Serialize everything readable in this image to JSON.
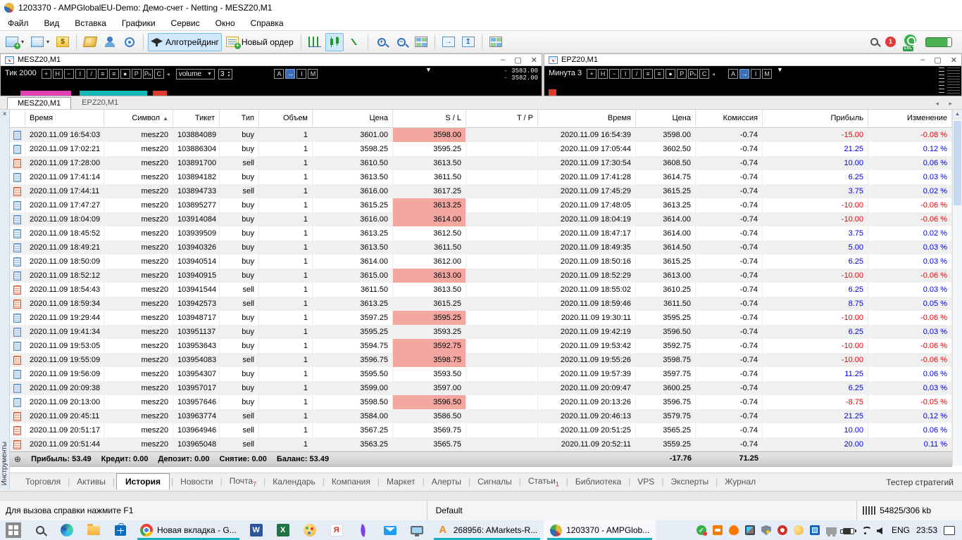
{
  "window": {
    "title": "1203370 - AMPGlobalEU-Demo: Демо-счет - Netting - MESZ20,M1"
  },
  "menu": [
    "Файл",
    "Вид",
    "Вставка",
    "Графики",
    "Сервис",
    "Окно",
    "Справка"
  ],
  "glyphs": {
    "caret": "▾",
    "caret_down": "▼",
    "sort_asc": "▲",
    "marker": "▼",
    "min": "–",
    "max": "▢",
    "close": "✕",
    "x": "×",
    "up_small": "▲",
    "down_small": "▼",
    "scroll_up": "▲",
    "tab_left": "◂",
    "tab_right": "▸",
    "expand": "⊕",
    "divider": "◂"
  },
  "toolbar": {
    "items": [
      {
        "name": "new-chart",
        "dropdown": true
      },
      {
        "name": "profiles",
        "dropdown": true
      },
      {
        "name": "symbols"
      },
      "sep",
      {
        "name": "history-center"
      },
      {
        "name": "community"
      },
      {
        "name": "broadcast"
      },
      "sep",
      {
        "name": "algo-cap",
        "label": "Алготрейдинг",
        "active": true
      },
      {
        "name": "order-doc",
        "label": "Новый ордер"
      },
      "sep",
      {
        "name": "bars-chart"
      },
      {
        "name": "candles-chart",
        "active": true
      },
      {
        "name": "line-chart"
      },
      "sep",
      {
        "name": "zoom-in"
      },
      {
        "name": "zoom-out"
      },
      {
        "name": "tile-windows"
      },
      "sep",
      {
        "name": "shift-end"
      },
      {
        "name": "auto-scroll"
      },
      "sep",
      {
        "name": "arrange-windows"
      }
    ],
    "search_badge": "1",
    "lvl_label": "LVL"
  },
  "charts": [
    {
      "title": "MESZ20,M1",
      "mode_label": "Тик  2000",
      "buttons": [
        "+",
        "H",
        "−",
        "I",
        "/",
        "≡",
        "≡",
        "●",
        "P",
        "Pₕ",
        "C"
      ],
      "dropdown": "volume",
      "spin": "3",
      "right_buttons": [
        "A",
        "→",
        "I",
        "M"
      ],
      "prices": [
        "3583.00",
        "3582.00"
      ]
    },
    {
      "title": "EPZ20,M1",
      "mode_label": "Минута  3",
      "buttons": [
        "+",
        "H",
        "−",
        "I",
        "/",
        "≡",
        "≡",
        "●",
        "P",
        "Pₕ",
        "C"
      ],
      "right_buttons": [
        "A",
        "→",
        "I",
        "M"
      ],
      "prices": []
    }
  ],
  "chart_tabs": {
    "tabs": [
      "MESZ20,M1",
      "EPZ20,M1"
    ],
    "active": 0
  },
  "history": {
    "columns": [
      {
        "label": "Время",
        "align": "left"
      },
      {
        "label": "Символ",
        "sort": true
      },
      {
        "label": "Тикет"
      },
      {
        "label": "Тип"
      },
      {
        "label": "Объем"
      },
      {
        "label": "Цена"
      },
      {
        "label": "S / L"
      },
      {
        "label": "T / P"
      },
      {
        "label": "Время"
      },
      {
        "label": "Цена"
      },
      {
        "label": "Комиссия"
      },
      {
        "label": "Прибыль"
      },
      {
        "label": "Изменение"
      }
    ],
    "rows": [
      [
        "buy",
        "2020.11.09 16:54:03",
        "mesz20",
        "103884089",
        "1",
        "3601.00",
        "3598.00",
        1,
        "",
        "2020.11.09 16:54:39",
        "3598.00",
        "-0.74",
        "-15.00",
        "-0.08 %"
      ],
      [
        "buy",
        "2020.11.09 17:02:21",
        "mesz20",
        "103886304",
        "1",
        "3598.25",
        "3595.25",
        0,
        "",
        "2020.11.09 17:05:44",
        "3602.50",
        "-0.74",
        "21.25",
        "0.12 %"
      ],
      [
        "sell",
        "2020.11.09 17:28:00",
        "mesz20",
        "103891700",
        "1",
        "3610.50",
        "3613.50",
        0,
        "",
        "2020.11.09 17:30:54",
        "3608.50",
        "-0.74",
        "10.00",
        "0.06 %"
      ],
      [
        "buy",
        "2020.11.09 17:41:14",
        "mesz20",
        "103894182",
        "1",
        "3613.50",
        "3611.50",
        0,
        "",
        "2020.11.09 17:41:28",
        "3614.75",
        "-0.74",
        "6.25",
        "0.03 %"
      ],
      [
        "sell",
        "2020.11.09 17:44:11",
        "mesz20",
        "103894733",
        "1",
        "3616.00",
        "3617.25",
        0,
        "",
        "2020.11.09 17:45:29",
        "3615.25",
        "-0.74",
        "3.75",
        "0.02 %"
      ],
      [
        "buy",
        "2020.11.09 17:47:27",
        "mesz20",
        "103895277",
        "1",
        "3615.25",
        "3613.25",
        1,
        "",
        "2020.11.09 17:48:05",
        "3613.25",
        "-0.74",
        "-10.00",
        "-0.06 %"
      ],
      [
        "buy",
        "2020.11.09 18:04:09",
        "mesz20",
        "103914084",
        "1",
        "3616.00",
        "3614.00",
        1,
        "",
        "2020.11.09 18:04:19",
        "3614.00",
        "-0.74",
        "-10.00",
        "-0.06 %"
      ],
      [
        "buy",
        "2020.11.09 18:45:52",
        "mesz20",
        "103939509",
        "1",
        "3613.25",
        "3612.50",
        0,
        "",
        "2020.11.09 18:47:17",
        "3614.00",
        "-0.74",
        "3.75",
        "0.02 %"
      ],
      [
        "buy",
        "2020.11.09 18:49:21",
        "mesz20",
        "103940326",
        "1",
        "3613.50",
        "3611.50",
        0,
        "",
        "2020.11.09 18:49:35",
        "3614.50",
        "-0.74",
        "5.00",
        "0.03 %"
      ],
      [
        "buy",
        "2020.11.09 18:50:09",
        "mesz20",
        "103940514",
        "1",
        "3614.00",
        "3612.00",
        0,
        "",
        "2020.11.09 18:50:16",
        "3615.25",
        "-0.74",
        "6.25",
        "0.03 %"
      ],
      [
        "buy",
        "2020.11.09 18:52:12",
        "mesz20",
        "103940915",
        "1",
        "3615.00",
        "3613.00",
        1,
        "",
        "2020.11.09 18:52:29",
        "3613.00",
        "-0.74",
        "-10.00",
        "-0.06 %"
      ],
      [
        "sell",
        "2020.11.09 18:54:43",
        "mesz20",
        "103941544",
        "1",
        "3611.50",
        "3613.50",
        0,
        "",
        "2020.11.09 18:55:02",
        "3610.25",
        "-0.74",
        "6.25",
        "0.03 %"
      ],
      [
        "sell",
        "2020.11.09 18:59:34",
        "mesz20",
        "103942573",
        "1",
        "3613.25",
        "3615.25",
        0,
        "",
        "2020.11.09 18:59:46",
        "3611.50",
        "-0.74",
        "8.75",
        "0.05 %"
      ],
      [
        "buy",
        "2020.11.09 19:29:44",
        "mesz20",
        "103948717",
        "1",
        "3597.25",
        "3595.25",
        1,
        "",
        "2020.11.09 19:30:11",
        "3595.25",
        "-0.74",
        "-10.00",
        "-0.06 %"
      ],
      [
        "buy",
        "2020.11.09 19:41:34",
        "mesz20",
        "103951137",
        "1",
        "3595.25",
        "3593.25",
        0,
        "",
        "2020.11.09 19:42:19",
        "3596.50",
        "-0.74",
        "6.25",
        "0.03 %"
      ],
      [
        "buy",
        "2020.11.09 19:53:05",
        "mesz20",
        "103953643",
        "1",
        "3594.75",
        "3592.75",
        1,
        "",
        "2020.11.09 19:53:42",
        "3592.75",
        "-0.74",
        "-10.00",
        "-0.06 %"
      ],
      [
        "sell",
        "2020.11.09 19:55:09",
        "mesz20",
        "103954083",
        "1",
        "3596.75",
        "3598.75",
        1,
        "",
        "2020.11.09 19:55:26",
        "3598.75",
        "-0.74",
        "-10.00",
        "-0.06 %"
      ],
      [
        "buy",
        "2020.11.09 19:56:09",
        "mesz20",
        "103954307",
        "1",
        "3595.50",
        "3593.50",
        0,
        "",
        "2020.11.09 19:57:39",
        "3597.75",
        "-0.74",
        "11.25",
        "0.06 %"
      ],
      [
        "buy",
        "2020.11.09 20:09:38",
        "mesz20",
        "103957017",
        "1",
        "3599.00",
        "3597.00",
        0,
        "",
        "2020.11.09 20:09:47",
        "3600.25",
        "-0.74",
        "6.25",
        "0.03 %"
      ],
      [
        "buy",
        "2020.11.09 20:13:00",
        "mesz20",
        "103957646",
        "1",
        "3598.50",
        "3596.50",
        1,
        "",
        "2020.11.09 20:13:26",
        "3596.75",
        "-0.74",
        "-8.75",
        "-0.05 %"
      ],
      [
        "sell",
        "2020.11.09 20:45:11",
        "mesz20",
        "103963774",
        "1",
        "3584.00",
        "3586.50",
        0,
        "",
        "2020.11.09 20:46:13",
        "3579.75",
        "-0.74",
        "21.25",
        "0.12 %"
      ],
      [
        "sell",
        "2020.11.09 20:51:17",
        "mesz20",
        "103964946",
        "1",
        "3567.25",
        "3569.75",
        0,
        "",
        "2020.11.09 20:51:25",
        "3565.25",
        "-0.74",
        "10.00",
        "0.06 %"
      ],
      [
        "sell",
        "2020.11.09 20:51:44",
        "mesz20",
        "103965048",
        "1",
        "3563.25",
        "3565.75",
        0,
        "",
        "2020.11.09 20:52:11",
        "3559.25",
        "-0.74",
        "20.00",
        "0.11 %"
      ]
    ],
    "summary": {
      "parts": [
        "Прибыль: 53.49",
        "Кредит: 0.00",
        "Депозит: 0.00",
        "Снятие: 0.00",
        "Баланс: 53.49"
      ],
      "commission_total": "-17.76",
      "profit_total": "71.25"
    }
  },
  "toolbox": {
    "side_label": "Инструменты",
    "tabs": [
      {
        "label": "Торговля"
      },
      {
        "label": "Активы"
      },
      {
        "label": "История",
        "active": true
      },
      {
        "label": "Новости"
      },
      {
        "label": "Почта",
        "badge": "7"
      },
      {
        "label": "Календарь"
      },
      {
        "label": "Компания"
      },
      {
        "label": "Маркет"
      },
      {
        "label": "Алерты"
      },
      {
        "label": "Сигналы"
      },
      {
        "label": "Статьи",
        "badge": "1"
      },
      {
        "label": "Библиотека"
      },
      {
        "label": "VPS"
      },
      {
        "label": "Эксперты"
      },
      {
        "label": "Журнал"
      }
    ],
    "right_label": "Тестер стратегий"
  },
  "status_bar": {
    "help": "Для вызова справки нажмите F1",
    "profile": "Default",
    "traffic": "54825/306 kb"
  },
  "taskbar": {
    "apps": [
      {
        "name": "start"
      },
      {
        "name": "searchtb"
      },
      {
        "name": "edge"
      },
      {
        "name": "explorer"
      },
      {
        "name": "store"
      },
      {
        "name": "chrome",
        "label": "Новая вкладка - G...",
        "underline": true
      },
      {
        "name": "word"
      },
      {
        "name": "excel"
      },
      {
        "name": "palette"
      },
      {
        "name": "yandex"
      },
      {
        "name": "quill"
      },
      {
        "name": "mail"
      },
      {
        "name": "rdp"
      },
      {
        "name": "amarkets",
        "label": "268956: AMarkets-R...",
        "underline": true
      },
      {
        "name": "mt5",
        "label": "1203370 - AMPGlob...",
        "underline": true,
        "active": true
      }
    ],
    "tray": [
      "check",
      "orangebox",
      "avast",
      "monitor",
      "shield",
      "redstar",
      "palette2",
      "blueapp",
      "monitor2",
      "battery",
      "wifi",
      "volume"
    ],
    "lang": "ENG",
    "time": "23:53"
  }
}
